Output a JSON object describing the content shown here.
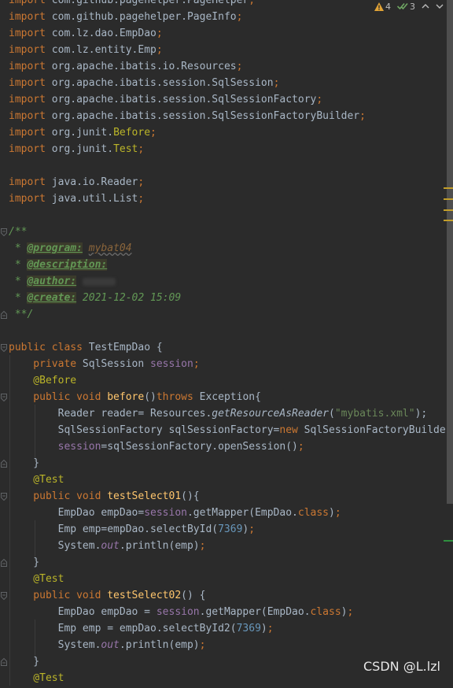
{
  "colors": {
    "background": "#2b2b2b",
    "keyword": "#cc7832",
    "plain": "#a9b7c6",
    "annotation": "#bbb529",
    "function": "#ffc66d",
    "string": "#6a8759",
    "number": "#6897bb",
    "field": "#9876aa",
    "doc": "#629755"
  },
  "inspection": {
    "warnings": "4",
    "weak_warnings": "3"
  },
  "code_lines": [
    [
      {
        "t": "import",
        "c": "kw"
      },
      {
        "t": " com.github.pagehelper.PageHelper",
        "c": "plain"
      },
      {
        "t": ";",
        "c": "kw"
      }
    ],
    [
      {
        "t": "import",
        "c": "kw"
      },
      {
        "t": " com.github.pagehelper.PageInfo",
        "c": "plain"
      },
      {
        "t": ";",
        "c": "kw"
      }
    ],
    [
      {
        "t": "import",
        "c": "kw"
      },
      {
        "t": " com.lz.dao.EmpDao",
        "c": "plain"
      },
      {
        "t": ";",
        "c": "kw"
      }
    ],
    [
      {
        "t": "import",
        "c": "kw"
      },
      {
        "t": " com.lz.entity.Emp",
        "c": "plain"
      },
      {
        "t": ";",
        "c": "kw"
      }
    ],
    [
      {
        "t": "import",
        "c": "kw"
      },
      {
        "t": " org.apache.ibatis.io.Resources",
        "c": "plain"
      },
      {
        "t": ";",
        "c": "kw"
      }
    ],
    [
      {
        "t": "import",
        "c": "kw"
      },
      {
        "t": " org.apache.ibatis.session.SqlSession",
        "c": "plain"
      },
      {
        "t": ";",
        "c": "kw"
      }
    ],
    [
      {
        "t": "import",
        "c": "kw"
      },
      {
        "t": " org.apache.ibatis.session.SqlSessionFactory",
        "c": "plain"
      },
      {
        "t": ";",
        "c": "kw"
      }
    ],
    [
      {
        "t": "import",
        "c": "kw"
      },
      {
        "t": " org.apache.ibatis.session.SqlSessionFactoryBuilder",
        "c": "plain"
      },
      {
        "t": ";",
        "c": "kw"
      }
    ],
    [
      {
        "t": "import",
        "c": "kw"
      },
      {
        "t": " org.junit.",
        "c": "plain"
      },
      {
        "t": "Before",
        "c": "ann"
      },
      {
        "t": ";",
        "c": "kw"
      }
    ],
    [
      {
        "t": "import",
        "c": "kw"
      },
      {
        "t": " org.junit.",
        "c": "plain"
      },
      {
        "t": "Test",
        "c": "ann"
      },
      {
        "t": ";",
        "c": "kw"
      }
    ],
    [],
    [
      {
        "t": "import",
        "c": "kw"
      },
      {
        "t": " java.io.Reader",
        "c": "plain"
      },
      {
        "t": ";",
        "c": "kw"
      }
    ],
    [
      {
        "t": "import",
        "c": "kw"
      },
      {
        "t": " java.util.List",
        "c": "plain"
      },
      {
        "t": ";",
        "c": "kw"
      }
    ],
    [],
    [
      {
        "t": "/**",
        "c": "doc"
      }
    ],
    [
      {
        "t": " * ",
        "c": "doc"
      },
      {
        "t": "@program:",
        "c": "tag"
      },
      {
        "t": " ",
        "c": "doc"
      },
      {
        "t": "mybat04",
        "c": "docval"
      }
    ],
    [
      {
        "t": " * ",
        "c": "doc"
      },
      {
        "t": "@description:",
        "c": "tag"
      }
    ],
    [
      {
        "t": " * ",
        "c": "doc"
      },
      {
        "t": "@author:",
        "c": "tag"
      },
      {
        "t": " ",
        "c": "doc"
      },
      {
        "t": "",
        "c": "blur"
      }
    ],
    [
      {
        "t": " * ",
        "c": "doc"
      },
      {
        "t": "@create:",
        "c": "tag"
      },
      {
        "t": " 2021-12-02 15:09",
        "c": "doc"
      }
    ],
    [
      {
        "t": " **/",
        "c": "doc"
      }
    ],
    [],
    [
      {
        "t": "public class",
        "c": "kw"
      },
      {
        "t": " TestEmpDao {",
        "c": "plain"
      }
    ],
    [
      {
        "t": "    private",
        "c": "kw"
      },
      {
        "t": " SqlSession ",
        "c": "plain"
      },
      {
        "t": "session",
        "c": "fld"
      },
      {
        "t": ";",
        "c": "kw"
      }
    ],
    [
      {
        "t": "    @Before",
        "c": "ann"
      }
    ],
    [
      {
        "t": "    public void",
        "c": "kw"
      },
      {
        "t": " ",
        "c": "plain"
      },
      {
        "t": "before",
        "c": "fn"
      },
      {
        "t": "()",
        "c": "plain"
      },
      {
        "t": "throws",
        "c": "kw"
      },
      {
        "t": " Exception{",
        "c": "plain"
      }
    ],
    [
      {
        "t": "        Reader reader= Resources.",
        "c": "plain"
      },
      {
        "t": "getResourceAsReader",
        "c": "ital"
      },
      {
        "t": "(",
        "c": "plain"
      },
      {
        "t": "\"mybatis.xml\"",
        "c": "str"
      },
      {
        "t": ");",
        "c": "plain"
      }
    ],
    [
      {
        "t": "        SqlSessionFactory sqlSessionFactory=",
        "c": "plain"
      },
      {
        "t": "new",
        "c": "kw"
      },
      {
        "t": " SqlSessionFactoryBuilde",
        "c": "plain"
      }
    ],
    [
      {
        "t": "        ",
        "c": "plain"
      },
      {
        "t": "session",
        "c": "fld"
      },
      {
        "t": "=sqlSessionFactory.openSession()",
        "c": "plain"
      },
      {
        "t": ";",
        "c": "kw"
      }
    ],
    [
      {
        "t": "    }",
        "c": "plain"
      }
    ],
    [
      {
        "t": "    @Test",
        "c": "ann"
      }
    ],
    [
      {
        "t": "    public void",
        "c": "kw"
      },
      {
        "t": " ",
        "c": "plain"
      },
      {
        "t": "testSelect01",
        "c": "fn"
      },
      {
        "t": "(){",
        "c": "plain"
      }
    ],
    [
      {
        "t": "        EmpDao empDao=",
        "c": "plain"
      },
      {
        "t": "session",
        "c": "fld"
      },
      {
        "t": ".getMapper(EmpDao.",
        "c": "plain"
      },
      {
        "t": "class",
        "c": "kw"
      },
      {
        "t": ")",
        "c": "plain"
      },
      {
        "t": ";",
        "c": "kw"
      }
    ],
    [
      {
        "t": "        Emp emp=empDao.selectById(",
        "c": "plain"
      },
      {
        "t": "7369",
        "c": "num"
      },
      {
        "t": ")",
        "c": "plain"
      },
      {
        "t": ";",
        "c": "kw"
      }
    ],
    [
      {
        "t": "        System.",
        "c": "plain"
      },
      {
        "t": "out",
        "c": "static"
      },
      {
        "t": ".println(emp)",
        "c": "plain"
      },
      {
        "t": ";",
        "c": "kw"
      }
    ],
    [
      {
        "t": "    }",
        "c": "plain"
      }
    ],
    [
      {
        "t": "    @Test",
        "c": "ann"
      }
    ],
    [
      {
        "t": "    public void",
        "c": "kw"
      },
      {
        "t": " ",
        "c": "plain"
      },
      {
        "t": "testSelect02",
        "c": "fn"
      },
      {
        "t": "() {",
        "c": "plain"
      }
    ],
    [
      {
        "t": "        EmpDao empDao = ",
        "c": "plain"
      },
      {
        "t": "session",
        "c": "fld"
      },
      {
        "t": ".getMapper(EmpDao.",
        "c": "plain"
      },
      {
        "t": "class",
        "c": "kw"
      },
      {
        "t": ")",
        "c": "plain"
      },
      {
        "t": ";",
        "c": "kw"
      }
    ],
    [
      {
        "t": "        Emp emp = empDao.selectById2(",
        "c": "plain"
      },
      {
        "t": "7369",
        "c": "num"
      },
      {
        "t": ")",
        "c": "plain"
      },
      {
        "t": ";",
        "c": "kw"
      }
    ],
    [
      {
        "t": "        System.",
        "c": "plain"
      },
      {
        "t": "out",
        "c": "static"
      },
      {
        "t": ".println(emp)",
        "c": "plain"
      },
      {
        "t": ";",
        "c": "kw"
      }
    ],
    [
      {
        "t": "    }",
        "c": "plain"
      }
    ],
    [
      {
        "t": "    @Test",
        "c": "ann"
      }
    ]
  ],
  "watermark": "CSDN @L.lzl"
}
